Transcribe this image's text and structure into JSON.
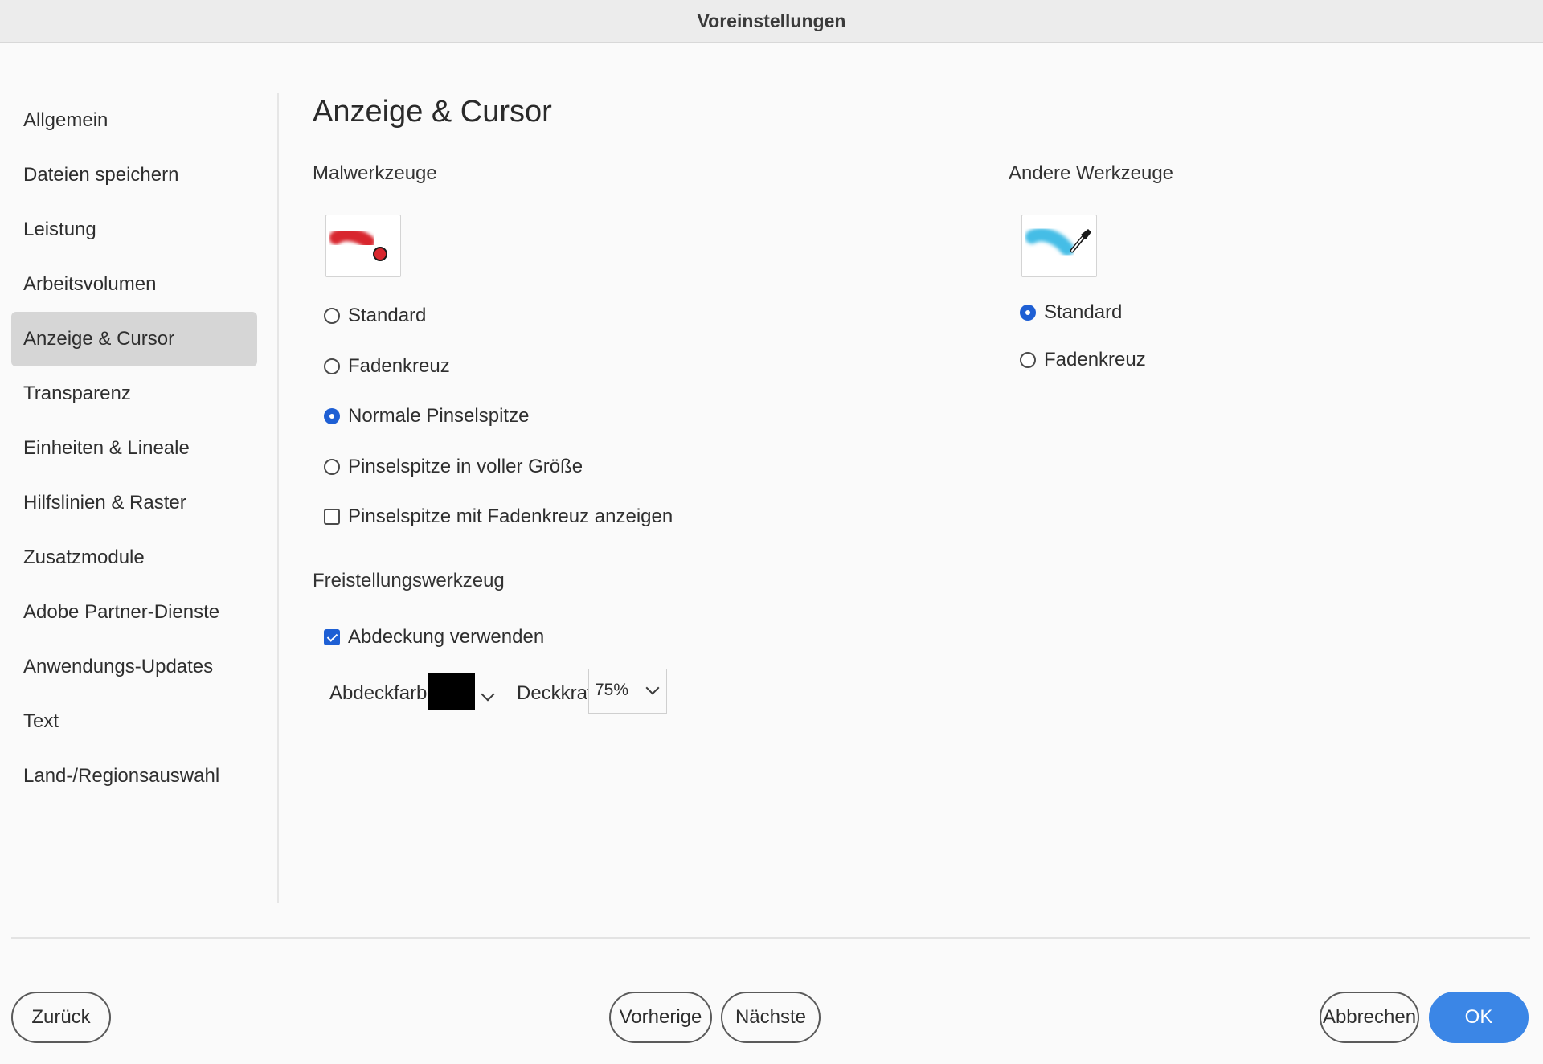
{
  "window": {
    "title": "Voreinstellungen"
  },
  "sidebar": {
    "items": [
      {
        "label": "Allgemein"
      },
      {
        "label": "Dateien speichern"
      },
      {
        "label": "Leistung"
      },
      {
        "label": "Arbeitsvolumen"
      },
      {
        "label": "Anzeige & Cursor",
        "selected": true
      },
      {
        "label": "Transparenz"
      },
      {
        "label": "Einheiten & Lineale"
      },
      {
        "label": "Hilfslinien & Raster"
      },
      {
        "label": "Zusatzmodule"
      },
      {
        "label": "Adobe Partner-Dienste"
      },
      {
        "label": "Anwendungs-Updates"
      },
      {
        "label": "Text"
      },
      {
        "label": "Land-/Regionsauswahl"
      }
    ]
  },
  "main": {
    "title": "Anzeige & Cursor",
    "painting_tools": {
      "label": "Malwerkzeuge",
      "options": [
        {
          "label": "Standard",
          "type": "radio",
          "checked": false
        },
        {
          "label": "Fadenkreuz",
          "type": "radio",
          "checked": false
        },
        {
          "label": "Normale Pinselspitze",
          "type": "radio",
          "checked": true
        },
        {
          "label": "Pinselspitze in voller Größe",
          "type": "radio",
          "checked": false
        },
        {
          "label": "Pinselspitze mit Fadenkreuz anzeigen",
          "type": "checkbox",
          "checked": false
        }
      ]
    },
    "other_tools": {
      "label": "Andere Werkzeuge",
      "options": [
        {
          "label": "Standard",
          "type": "radio",
          "checked": true
        },
        {
          "label": "Fadenkreuz",
          "type": "radio",
          "checked": false
        }
      ]
    },
    "crop_tool": {
      "label": "Freistellungswerkzeug",
      "use_shield": {
        "label": "Abdeckung verwenden",
        "checked": true
      },
      "shield_color_label": "Abdeckfarbe:",
      "shield_color": "#000000",
      "opacity_label": "Deckkraft:",
      "opacity_value": "75%"
    }
  },
  "footer": {
    "back": "Zurück",
    "previous": "Vorherige",
    "next": "Nächste",
    "cancel": "Abbrechen",
    "ok": "OK"
  },
  "colors": {
    "accent": "#1e5fd4",
    "ok_button": "#3b86e6",
    "selected_nav": "#d6d6d6",
    "brush_red": "#d8262e",
    "brush_blue": "#45bde6"
  }
}
